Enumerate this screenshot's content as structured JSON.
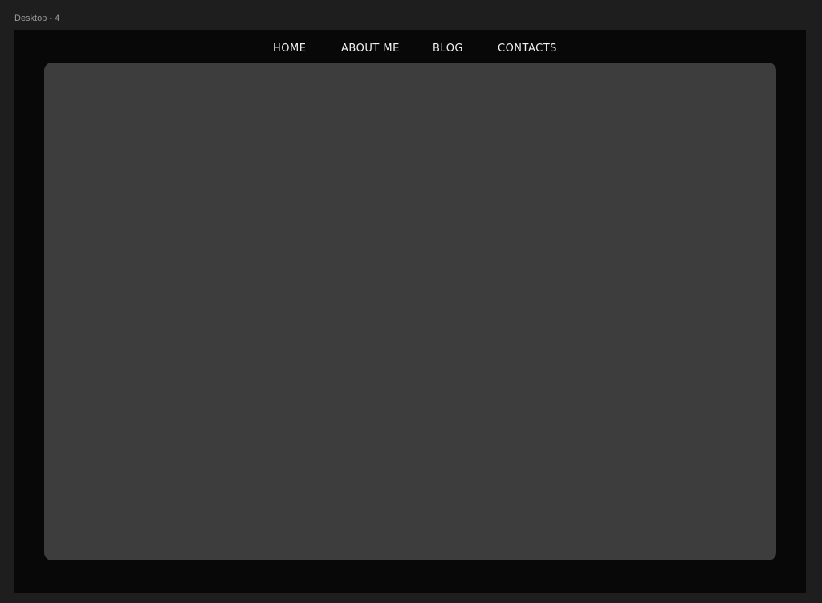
{
  "frame": {
    "label": "Desktop - 4"
  },
  "nav": {
    "items": [
      {
        "label": "HOME"
      },
      {
        "label": "ABOUT ME"
      },
      {
        "label": "BLOG"
      },
      {
        "label": "CONTACTS"
      }
    ]
  },
  "colors": {
    "canvas_background": "#1e1e1e",
    "frame_background": "#080808",
    "panel_background": "#3d3d3d",
    "nav_text": "#f2f2f2",
    "frame_label_text": "#9a9a9a"
  }
}
